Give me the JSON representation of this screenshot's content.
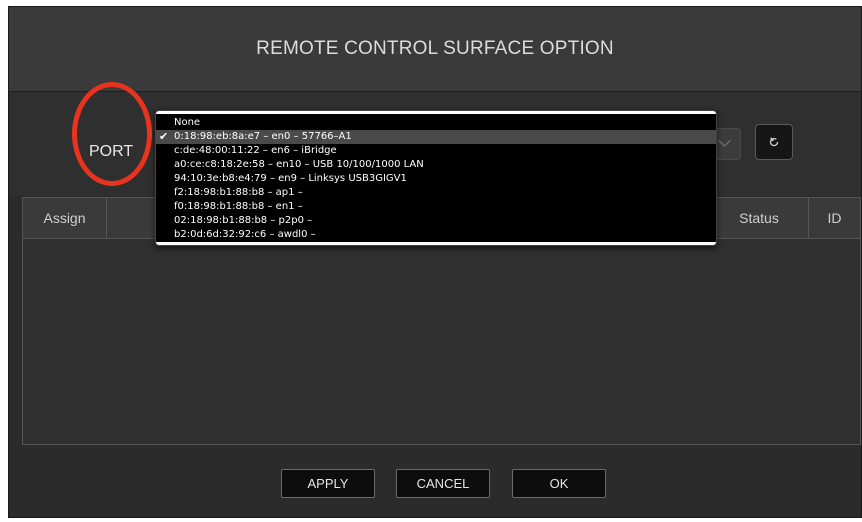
{
  "dialog": {
    "title": "REMOTE CONTROL SURFACE OPTION"
  },
  "port": {
    "label": "PORT",
    "selected_index": 1,
    "options": [
      "None",
      "0:18:98:eb:8a:e7 – en0 – 57766–A1",
      "c:de:48:00:11:22 – en6 – iBridge",
      "a0:ce:c8:18:2e:58 – en10 – USB 10/100/1000 LAN",
      "94:10:3e:b8:e4:79 – en9 – Linksys USB3GIGV1",
      "f2:18:98:b1:88:b8 – ap1 –",
      "f0:18:98:b1:88:b8 – en1 –",
      "02:18:98:b1:88:b8 – p2p0 –",
      "b2:0d:6d:32:92:c6 – awdl0 –"
    ],
    "check_glyph": "✔"
  },
  "table": {
    "columns": [
      "Assign",
      "Status",
      "ID"
    ]
  },
  "footer": {
    "apply_label": "APPLY",
    "cancel_label": "CANCEL",
    "ok_label": "OK"
  },
  "icons": {
    "refresh": "refresh-icon",
    "chevron": "chevron-down-icon"
  },
  "colors": {
    "highlight_circle": "#e8341f",
    "menu_background": "#000000",
    "dialog_background": "#2b2b2b"
  }
}
